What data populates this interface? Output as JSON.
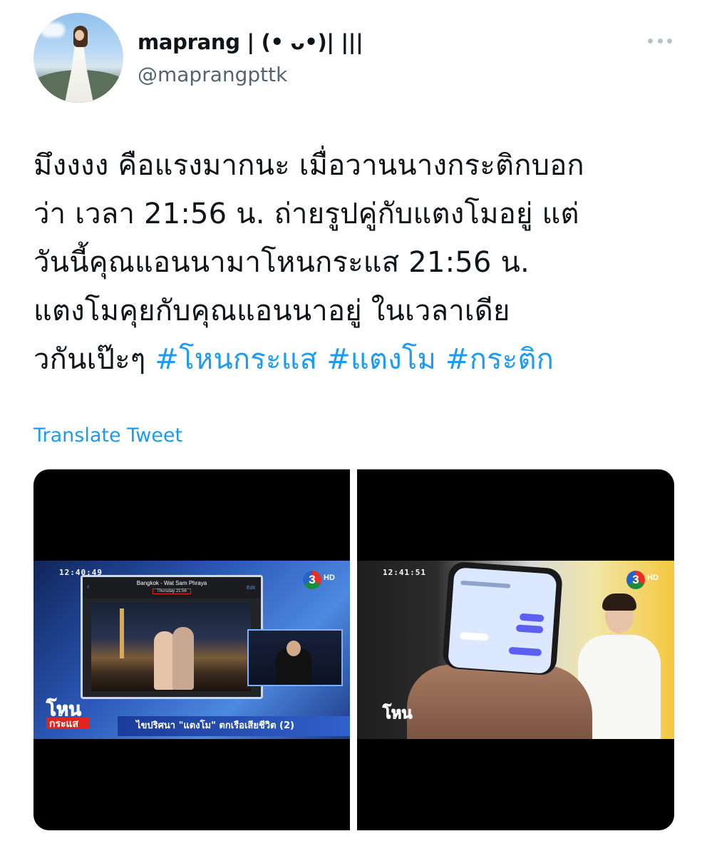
{
  "author": {
    "name": "maprang | (• ᴗ•)| |||",
    "handle": "@maprangpttk"
  },
  "tweet": {
    "lines": [
      [
        {
          "text": "มึงงงง คือแรงมากนะ เมื่อวานนางกระติกบอก",
          "type": "text"
        }
      ],
      [
        {
          "text": "ว่า เวลา 21:56 น. ถ่ายรูปคู่กับแตงโมอยู่ แต่",
          "type": "text"
        }
      ],
      [
        {
          "text": "วันนี้คุณแอนนามาโหนกระแส 21:56 น.",
          "type": "text"
        }
      ],
      [
        {
          "text": "แตงโมคุยกับคุณแอนนาอยู่  ในเวลาเดีย",
          "type": "text"
        }
      ],
      [
        {
          "text": "วกันเป๊ะๆ ",
          "type": "text"
        },
        {
          "text": "#โหนกระแส",
          "type": "hashtag"
        },
        {
          "text": " ",
          "type": "text"
        },
        {
          "text": "#แตงโม",
          "type": "hashtag"
        },
        {
          "text": " ",
          "type": "text"
        },
        {
          "text": "#กระติก",
          "type": "hashtag"
        }
      ]
    ],
    "translate_label": "Translate Tweet"
  },
  "media": {
    "left": {
      "timestamp": "12:40:49",
      "channel": "3",
      "channel_tag": "HD",
      "screen_place": "Bangkok - Wat Sam Phraya",
      "screen_time": "Thursday  21:56",
      "screen_edit": "Edit",
      "lower_third": "ไขปริศนา \"แตงโม\" ตกเรือเสียชีวิต (2)",
      "show_logo_top": "โหน",
      "show_logo_bottom": "กระแส"
    },
    "right": {
      "timestamp": "12:41:51",
      "channel": "3",
      "channel_tag": "HD",
      "show_logo": "โหน"
    }
  },
  "colors": {
    "link": "#1d9bf0",
    "secondary_text": "#536471",
    "primary_text": "#0f1419"
  }
}
